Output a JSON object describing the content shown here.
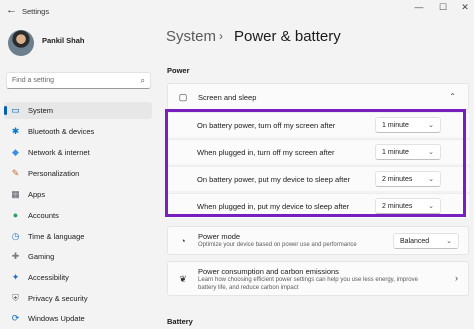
{
  "window": {
    "back_glyph": "←",
    "title": "Settings",
    "minimize": "—",
    "maximize": "☐",
    "close": "✕"
  },
  "profile": {
    "name": "Pankil Shah"
  },
  "search": {
    "placeholder": "Find a setting"
  },
  "sidebar": {
    "items": [
      {
        "label": "System",
        "icon": "monitor-icon",
        "glyph": "▭",
        "color": "#005fb8",
        "active": true
      },
      {
        "label": "Bluetooth & devices",
        "icon": "bluetooth-icon",
        "glyph": "✱",
        "color": "#0078d4"
      },
      {
        "label": "Network & internet",
        "icon": "wifi-icon",
        "glyph": "◆",
        "color": "#3a8ee6"
      },
      {
        "label": "Personalization",
        "icon": "brush-icon",
        "glyph": "✎",
        "color": "#c86a2b"
      },
      {
        "label": "Apps",
        "icon": "apps-icon",
        "glyph": "▦",
        "color": "#5b5b6b"
      },
      {
        "label": "Accounts",
        "icon": "person-icon",
        "glyph": "●",
        "color": "#2e9f5a"
      },
      {
        "label": "Time & language",
        "icon": "globe-clock-icon",
        "glyph": "◷",
        "color": "#1e73c9"
      },
      {
        "label": "Gaming",
        "icon": "gamepad-icon",
        "glyph": "✚",
        "color": "#7a7a7a"
      },
      {
        "label": "Accessibility",
        "icon": "accessibility-icon",
        "glyph": "✦",
        "color": "#1f6fc4"
      },
      {
        "label": "Privacy & security",
        "icon": "shield-icon",
        "glyph": "⛨",
        "color": "#6d6d6d"
      },
      {
        "label": "Windows Update",
        "icon": "update-icon",
        "glyph": "⟳",
        "color": "#0a64c2"
      }
    ]
  },
  "header": {
    "parent": "System",
    "separator": "›",
    "title": "Power & battery"
  },
  "sections": {
    "power": "Power",
    "battery": "Battery"
  },
  "screen_sleep": {
    "title": "Screen and sleep",
    "icon": "screen-sleep-icon",
    "expanded_glyph": "⌃"
  },
  "sleep_rows": [
    {
      "label": "On battery power, turn off my screen after",
      "value": "1 minute"
    },
    {
      "label": "When plugged in, turn off my screen after",
      "value": "1 minute"
    },
    {
      "label": "On battery power, put my device to sleep after",
      "value": "2 minutes"
    },
    {
      "label": "When plugged in, put my device to sleep after",
      "value": "2 minutes"
    }
  ],
  "dropdown_caret": "⌄",
  "power_mode": {
    "title": "Power mode",
    "desc": "Optimize your device based on power use and performance",
    "value": "Balanced",
    "icon": "power-mode-icon"
  },
  "consumption": {
    "title": "Power consumption and carbon emissions",
    "desc_line1": "Learn how choosing efficient power settings can help you use less energy, improve",
    "desc_line2": "battery life, and reduce carbon impact",
    "icon": "leaf-icon",
    "chevron": "›"
  },
  "colors": {
    "accent": "#005fb8",
    "highlight": "#7a1fbf"
  }
}
